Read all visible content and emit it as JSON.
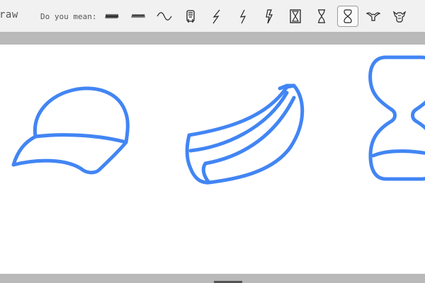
{
  "header": {
    "title": "raw",
    "did_you_mean_label": "Do you mean:"
  },
  "suggestions": [
    {
      "name": "squiggle-1"
    },
    {
      "name": "squiggle-2"
    },
    {
      "name": "wave"
    },
    {
      "name": "creature"
    },
    {
      "name": "lightning-1"
    },
    {
      "name": "lightning-2"
    },
    {
      "name": "lightning-3"
    },
    {
      "name": "hourglass-1"
    },
    {
      "name": "hourglass-2"
    },
    {
      "name": "hourglass-3",
      "selected": true
    },
    {
      "name": "bird-1"
    },
    {
      "name": "bird-2"
    }
  ],
  "canvas": {
    "stroke_color": "#4285f4",
    "drawings": [
      "baseball-cap",
      "banana",
      "hourglass"
    ]
  }
}
